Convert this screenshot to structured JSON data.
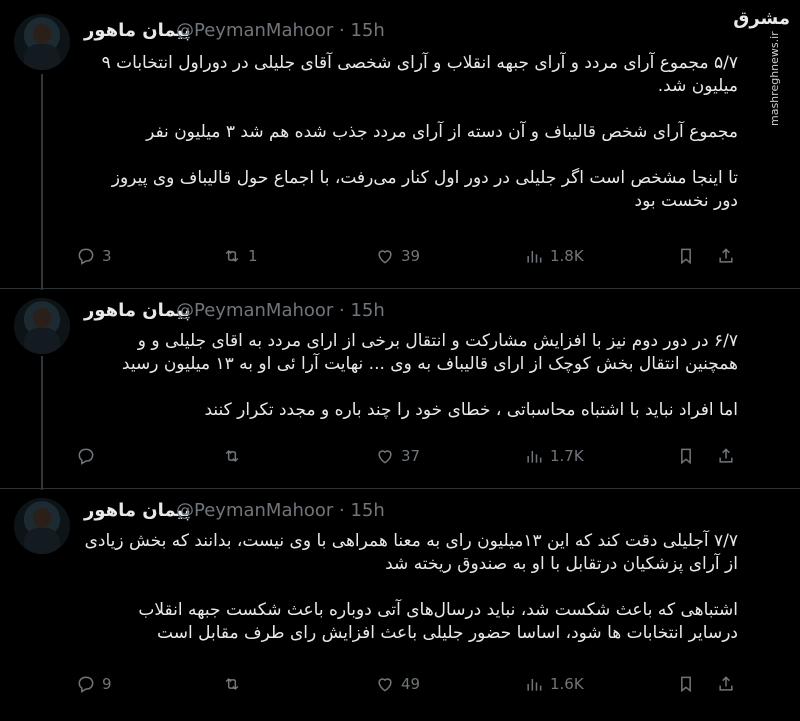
{
  "watermark": {
    "logo": "مشرق",
    "url": "mashreghnews.ir"
  },
  "tweets": [
    {
      "name": "پیمان ماهور",
      "handle": "@PeymanMahoor · 15h",
      "paragraphs": [
        "۵/۷ مجموع آرای مردد و آرای جبهه انقلاب و آرای شخصی آقای جلیلی در دوراول انتخابات ۹ میلیون شد.",
        "مجموع آرای شخص قالیباف و آن دسته از آرای مردد جذب شده هم شد ۳ میلیون نفر",
        "تا اینجا مشخص است اگر جلیلی در دور اول کنار می‌رفت، با اجماع حول قالیباف وی پیروز دور نخست بود"
      ],
      "replies": "3",
      "retweets": "1",
      "likes": "39",
      "views": "1.8K"
    },
    {
      "name": "پیمان ماهور",
      "handle": "@PeymanMahoor · 15h",
      "paragraphs": [
        "۶/۷ در دور دوم نیز با افزایش مشارکت و انتقال برخی از ارای مردد به اقای جلیلی و و همچنین انتقال بخش کوچک از ارای قالیباف به وی ... نهایت آرا ئی او به ۱۳ میلیون رسید",
        "اما افراد نباید با اشتباه محاسباتی ، خطای خود را چند باره و مجدد تکرار کنند"
      ],
      "replies": "",
      "retweets": "",
      "likes": "37",
      "views": "1.7K"
    },
    {
      "name": "پیمان ماهور",
      "handle": "@PeymanMahoor · 15h",
      "paragraphs": [
        "۷/۷ آجلیلی دقت کند که این ۱۳میلیون رای به معنا همراهی با وی نیست، بدانند که بخش زیادی از آرای پزشکیان درتقابل با او به صندوق ریخته شد",
        "اشتباهی که باعث شکست شد، نباید درسال‌های آتی دوباره باعث شکست جبهه انقلاب درسایر انتخابات ها شود، اساسا حضور جلیلی باعث افزایش رای طرف مقابل است"
      ],
      "replies": "9",
      "retweets": "",
      "likes": "49",
      "views": "1.6K"
    }
  ]
}
